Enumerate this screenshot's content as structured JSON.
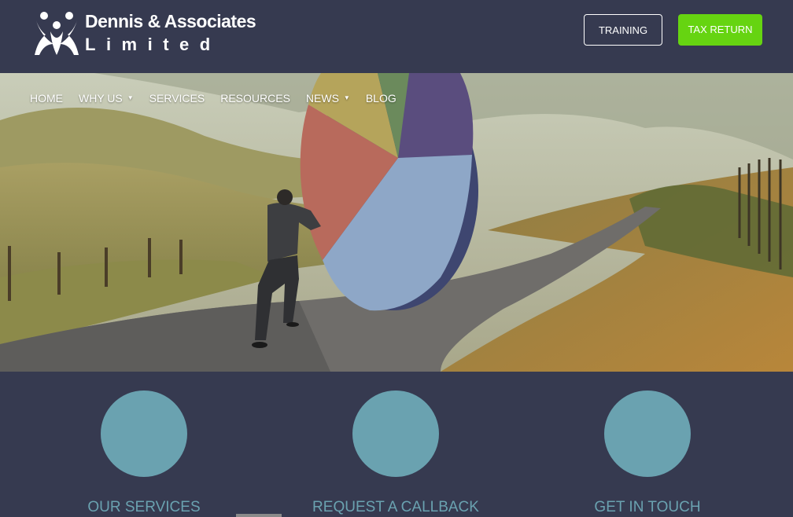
{
  "brand": {
    "name_line1": "Dennis & Associates",
    "name_line2": "Limited",
    "logo_icon": "people-logo-icon"
  },
  "header_buttons": {
    "training": "TRAINING",
    "tax_return": "TAX RETURN"
  },
  "nav": {
    "items": [
      {
        "label": "HOME",
        "dropdown": false
      },
      {
        "label": "WHY US",
        "dropdown": true
      },
      {
        "label": "SERVICES",
        "dropdown": false
      },
      {
        "label": "RESOURCES",
        "dropdown": false
      },
      {
        "label": "NEWS",
        "dropdown": true
      },
      {
        "label": "BLOG",
        "dropdown": false
      }
    ]
  },
  "features": [
    {
      "title": "OUR SERVICES"
    },
    {
      "title": "REQUEST A CALLBACK"
    },
    {
      "title": "GET IN TOUCH"
    }
  ],
  "colors": {
    "background": "#363a50",
    "accent_green": "#66d411",
    "feature_teal": "#6aa2b0"
  }
}
